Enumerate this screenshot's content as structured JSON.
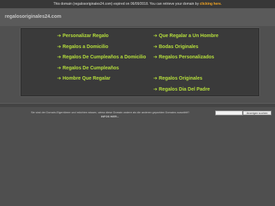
{
  "top_bar": {
    "message": "This domain (regalosoriginales24.com) expired on 06/09/2018. You can retrieve your domain by",
    "link_label": "clicking here."
  },
  "header": {
    "logo": "regalosoriginales24.com"
  },
  "links": {
    "arrow": "➔",
    "left": [
      "Personalizar Regalo",
      "Regalos a Domicilio",
      "Regalos De Cumpleaños a Domicilio",
      "Regalos De Cumpleaños",
      "Hombre Que Regalar"
    ],
    "right": [
      "Que Regalar a Un Hombre",
      "Bodas Originales",
      "Regalos Personalizados",
      "Regalos Originales",
      "Regalos Dia Del Padre"
    ]
  },
  "footer": {
    "notice": "Sie sind der Domain-Eigentümer und möchten wissen, wieso diese Domain andere als die anderen geparkten Domains auswählt?",
    "more_info": "INFOS HIER..."
  },
  "search": {
    "input_value": "",
    "button_label": "Anzeigen suchen"
  },
  "colors": {
    "link": "#b8e23c",
    "accent": "#f5a623"
  }
}
